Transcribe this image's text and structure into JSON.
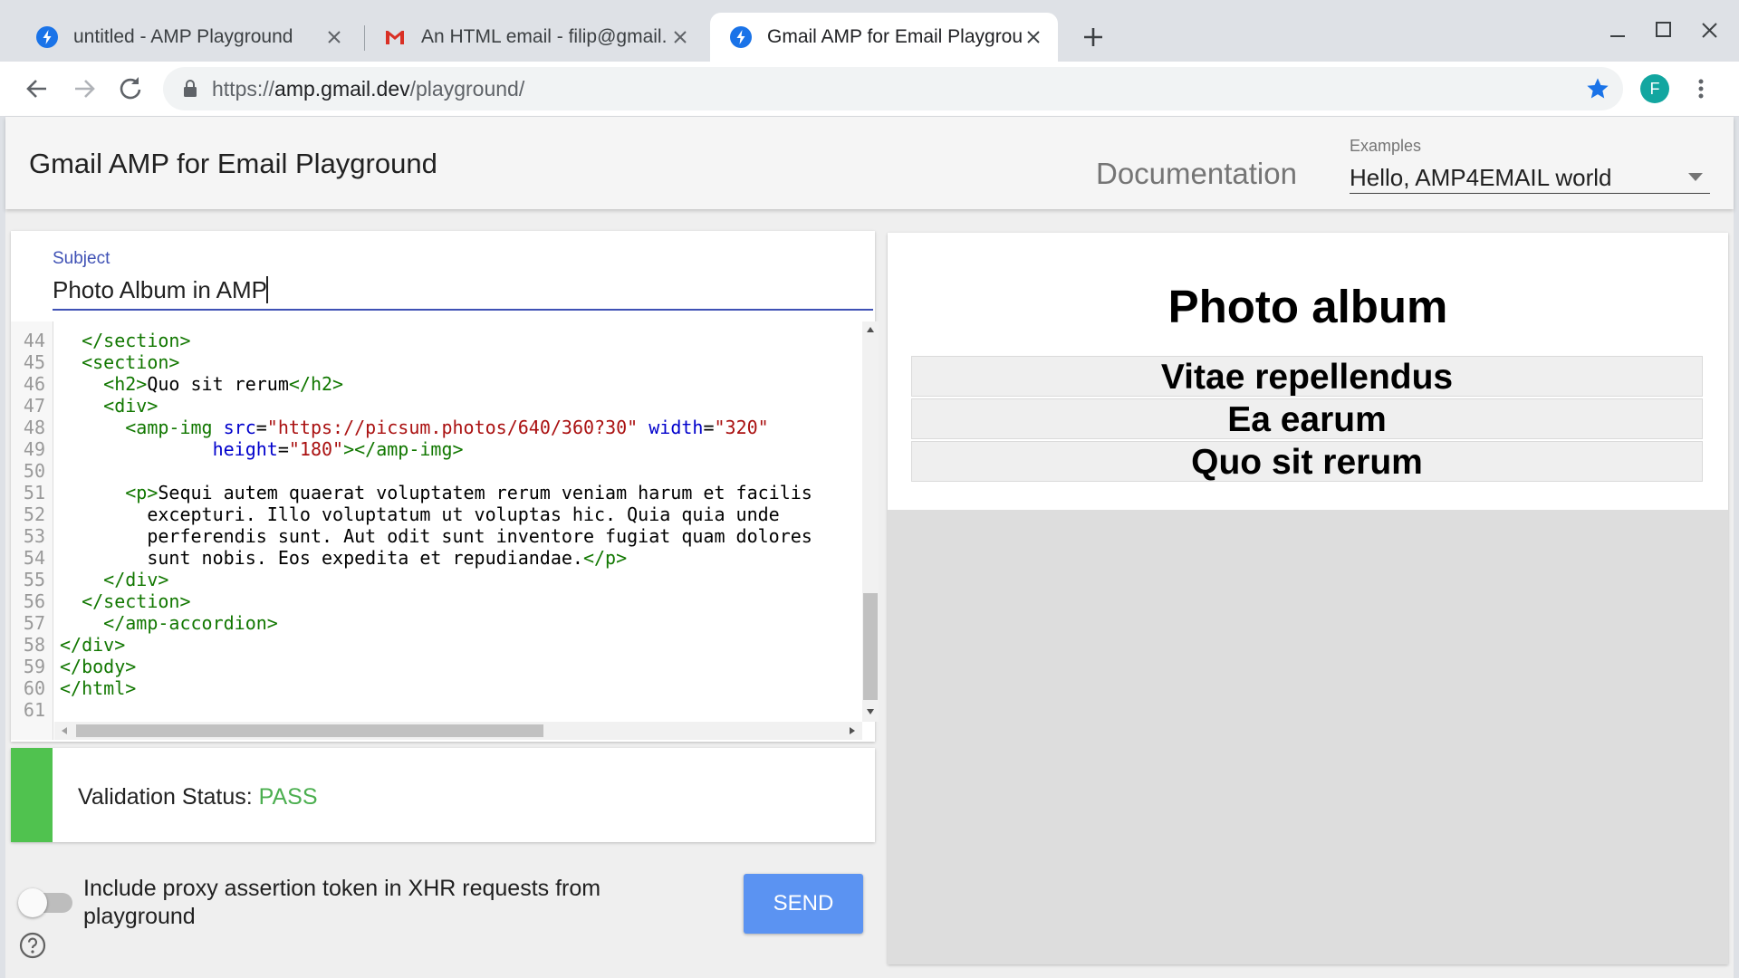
{
  "browser": {
    "tabs": [
      {
        "title": "untitled - AMP Playground",
        "icon": "amp-bolt-icon",
        "active": false
      },
      {
        "title": "An HTML email - filip@gmail.",
        "icon": "gmail-icon",
        "active": false
      },
      {
        "title": "Gmail AMP for Email Playgrou",
        "icon": "amp-bolt-icon",
        "active": true
      }
    ],
    "url_scheme": "https://",
    "url_host": "amp.gmail.dev",
    "url_path": "/playground/",
    "profile_initial": "F"
  },
  "header": {
    "title": "Gmail AMP for Email Playground",
    "documentation_link": "Documentation",
    "examples_label": "Examples",
    "examples_selected": "Hello, AMP4EMAIL world"
  },
  "editor": {
    "subject_label": "Subject",
    "subject_value": "Photo Album in AMP",
    "line_numbers": [
      "44",
      "45",
      "46",
      "47",
      "48",
      "49",
      "50",
      "51",
      "52",
      "53",
      "54",
      "55",
      "56",
      "57",
      "58",
      "59",
      "60",
      "61"
    ]
  },
  "validation": {
    "label": "Validation Status: ",
    "status": "PASS",
    "status_color": "#4caf50"
  },
  "footer": {
    "proxy_toggle_label": "Include proxy assertion token in XHR requests from playground",
    "proxy_toggle_on": false,
    "send_label": "SEND",
    "send_color": "#5b93f2"
  },
  "preview": {
    "title": "Photo album",
    "sections": [
      "Vitae repellendus",
      "Ea earum",
      "Quo sit rerum"
    ]
  },
  "colors": {
    "accent": "#3f51b5",
    "pass_bar": "#50c24f",
    "star": "#1a73e8"
  }
}
